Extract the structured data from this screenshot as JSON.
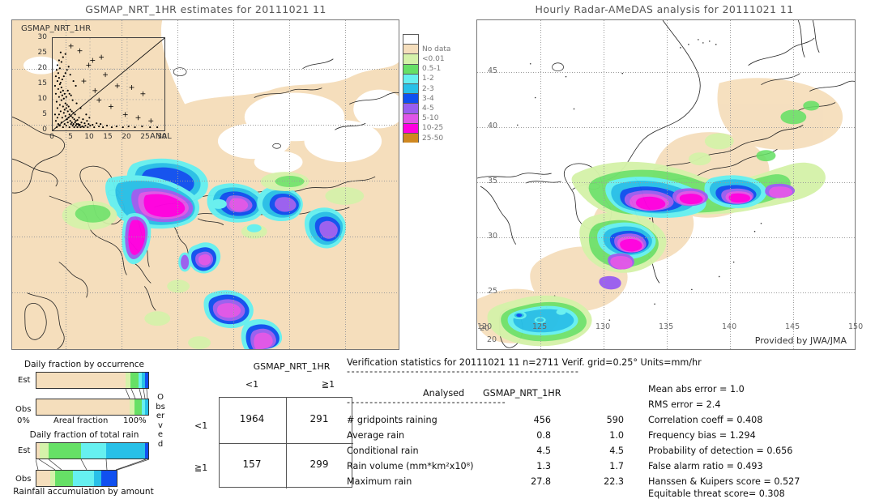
{
  "left_panel": {
    "title": "GSMAP_NRT_1HR estimates for 20111021 11",
    "inset": {
      "label": "GSMAP_NRT_1HR",
      "x_axis_label": "ANAL",
      "y_ticks": [
        "30",
        "25",
        "20",
        "15",
        "10",
        "5",
        "0"
      ],
      "x_ticks": [
        "0",
        "5",
        "10",
        "15",
        "20",
        "25",
        "30"
      ],
      "axis_min": 0,
      "axis_max": 30
    }
  },
  "right_panel": {
    "title": "Hourly Radar-AMeDAS analysis for 20111021 11",
    "x_ticks": [
      "120",
      "125",
      "130",
      "135",
      "140",
      "145",
      "150"
    ],
    "y_ticks": [
      "45",
      "40",
      "35",
      "30",
      "25",
      "20"
    ],
    "credit": "Provided by JWA/JMA"
  },
  "colorbar": {
    "labels": [
      "No data",
      "<0.01",
      "0.5-1",
      "1-2",
      "2-3",
      "3-4",
      "4-5",
      "5-10",
      "10-25",
      "25-50"
    ],
    "colors": [
      "#ffffff",
      "#f5debc",
      "#d5f2aa",
      "#66e066",
      "#66f0f0",
      "#28c0e8",
      "#1050f0",
      "#9a5ef0",
      "#e055e8",
      "#ff00e0",
      "#d08820"
    ]
  },
  "fraction_occurrence": {
    "title": "Daily fraction by occurrence",
    "rows": [
      {
        "label": "Est",
        "segments": [
          {
            "color": "#f5debc",
            "pct": 79.5
          },
          {
            "color": "#d5f2aa",
            "pct": 4.5
          },
          {
            "color": "#66e066",
            "pct": 7.0
          },
          {
            "color": "#66f0f0",
            "pct": 3.0
          },
          {
            "color": "#28c0e8",
            "pct": 3.0
          },
          {
            "color": "#1050f0",
            "pct": 3.0
          }
        ]
      },
      {
        "label": "Obs",
        "segments": [
          {
            "color": "#f5debc",
            "pct": 83.0
          },
          {
            "color": "#d5f2aa",
            "pct": 5.0
          },
          {
            "color": "#66e066",
            "pct": 6.0
          },
          {
            "color": "#66f0f0",
            "pct": 3.0
          },
          {
            "color": "#28c0e8",
            "pct": 3.0
          }
        ]
      }
    ],
    "axis_left": "0%",
    "axis_center": "Areal fraction",
    "axis_right": "100%"
  },
  "fraction_total_rain": {
    "title": "Daily fraction of total rain",
    "caption": "Rainfall accumulation by amount",
    "rows": [
      {
        "label": "Est",
        "segments": [
          {
            "color": "#f5debc",
            "pct": 3.0
          },
          {
            "color": "#d5f2aa",
            "pct": 8.0
          },
          {
            "color": "#66e066",
            "pct": 29.0
          },
          {
            "color": "#66f0f0",
            "pct": 22.0
          },
          {
            "color": "#28c0e8",
            "pct": 35.0
          },
          {
            "color": "#1050f0",
            "pct": 3.0
          }
        ]
      },
      {
        "label": "Obs",
        "segments": [
          {
            "color": "#f5debc",
            "pct": 17.0
          },
          {
            "color": "#d5f2aa",
            "pct": 6.0
          },
          {
            "color": "#66e066",
            "pct": 22.0
          },
          {
            "color": "#66f0f0",
            "pct": 27.0
          },
          {
            "color": "#28c0e8",
            "pct": 9.0
          },
          {
            "color": "#1050f0",
            "pct": 8.0
          }
        ]
      }
    ]
  },
  "contingency": {
    "title": "GSMAP_NRT_1HR",
    "col_headers": [
      "<1",
      "≧1"
    ],
    "row_headers": [
      "<1",
      "≧1"
    ],
    "axis_label": "Observed",
    "values": [
      [
        "1964",
        "291"
      ],
      [
        "157",
        "299"
      ]
    ]
  },
  "verification": {
    "header": "Verification statistics for 20111021 11  n=2711  Verif. grid=0.25°  Units=mm/hr",
    "divider_long": "---------------------------------------------------",
    "col_header_left": "Analysed",
    "col_header_right": "GSMAP_NRT_1HR",
    "divider_short": "-----------------------------------",
    "rows": [
      {
        "label": "# gridpoints raining",
        "analysed": "456",
        "estimate": "590"
      },
      {
        "label": "Average rain",
        "analysed": "0.8",
        "estimate": "1.0"
      },
      {
        "label": "Conditional rain",
        "analysed": "4.5",
        "estimate": "4.5"
      },
      {
        "label": "Rain volume (mm*km²x10⁸)",
        "analysed": "1.3",
        "estimate": "1.7"
      },
      {
        "label": "Maximum rain",
        "analysed": "27.8",
        "estimate": "22.3"
      }
    ],
    "scores": [
      "Mean abs error = 1.0",
      "RMS error = 2.4",
      "Correlation coeff = 0.408",
      "Frequency bias = 1.294",
      "Probability of detection = 0.656",
      "False alarm ratio = 0.493",
      "Hanssen & Kuipers score = 0.527",
      "Equitable threat score= 0.308"
    ]
  }
}
